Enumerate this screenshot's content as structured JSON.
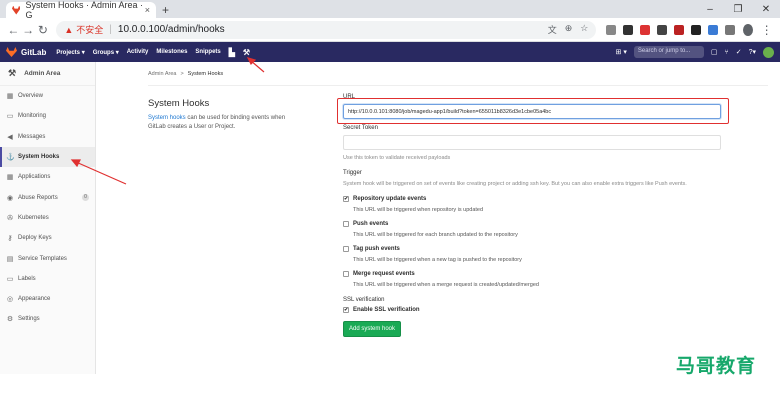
{
  "browser": {
    "tab_title": "System Hooks · Admin Area · G",
    "tab_close": "×",
    "new_tab": "+",
    "security_label": "不安全",
    "url": "10.0.0.100/admin/hooks",
    "nav_separator": "|",
    "window_controls": [
      "–",
      "❐",
      "✕"
    ]
  },
  "gitlab_nav": {
    "brand": "GitLab",
    "menu": [
      "Projects ▾",
      "Groups ▾",
      "Activity",
      "Milestones",
      "Snippets"
    ],
    "search_placeholder": "Search or jump to..."
  },
  "sidebar": {
    "header": "Admin Area",
    "items": [
      {
        "label": "Overview",
        "icon": "grid-icon"
      },
      {
        "label": "Monitoring",
        "icon": "monitor-icon"
      },
      {
        "label": "Messages",
        "icon": "bullhorn-icon"
      },
      {
        "label": "System Hooks",
        "icon": "hook-icon",
        "active": true
      },
      {
        "label": "Applications",
        "icon": "apps-icon"
      },
      {
        "label": "Abuse Reports",
        "icon": "alert-icon",
        "badge": "0"
      },
      {
        "label": "Kubernetes",
        "icon": "kubernetes-icon"
      },
      {
        "label": "Deploy Keys",
        "icon": "key-icon"
      },
      {
        "label": "Service Templates",
        "icon": "template-icon"
      },
      {
        "label": "Labels",
        "icon": "label-icon"
      },
      {
        "label": "Appearance",
        "icon": "appearance-icon"
      },
      {
        "label": "Settings",
        "icon": "settings-icon"
      }
    ]
  },
  "breadcrumb": {
    "parent": "Admin Area",
    "separator": ">",
    "current": "System Hooks"
  },
  "intro": {
    "title": "System Hooks",
    "link_text": "System hooks",
    "description": " can be used for binding events when GitLab creates a User or Project."
  },
  "form": {
    "url_label": "URL",
    "url_value": "http://10.0.0.101:8080/job/magedu-app1/build?token=655011b8326d3e1cbe05a4bc",
    "token_label": "Secret Token",
    "token_value": "",
    "token_help": "Use this token to validate received payloads",
    "trigger_label": "Trigger",
    "trigger_help": "System hook will be triggered on set of events like creating project or adding ssh key. But you can also enable extra triggers like Push events.",
    "triggers": [
      {
        "label": "Repository update events",
        "help": "This URL will be triggered when repository is updated",
        "checked": true
      },
      {
        "label": "Push events",
        "help": "This URL will be triggered for each branch updated to the repository",
        "checked": false
      },
      {
        "label": "Tag push events",
        "help": "This URL will be triggered when a new tag is pushed to the repository",
        "checked": false
      },
      {
        "label": "Merge request events",
        "help": "This URL will be triggered when a merge request is created/updated/merged",
        "checked": false
      }
    ],
    "ssl_label": "SSL verification",
    "ssl_option": "Enable SSL verification",
    "ssl_checked": true,
    "submit": "Add system hook"
  },
  "watermark": "马哥教育",
  "colors": {
    "nav_bg": "#292961",
    "accent": "#1aaa55",
    "annotation": "#e03030",
    "link": "#1f78d1"
  }
}
